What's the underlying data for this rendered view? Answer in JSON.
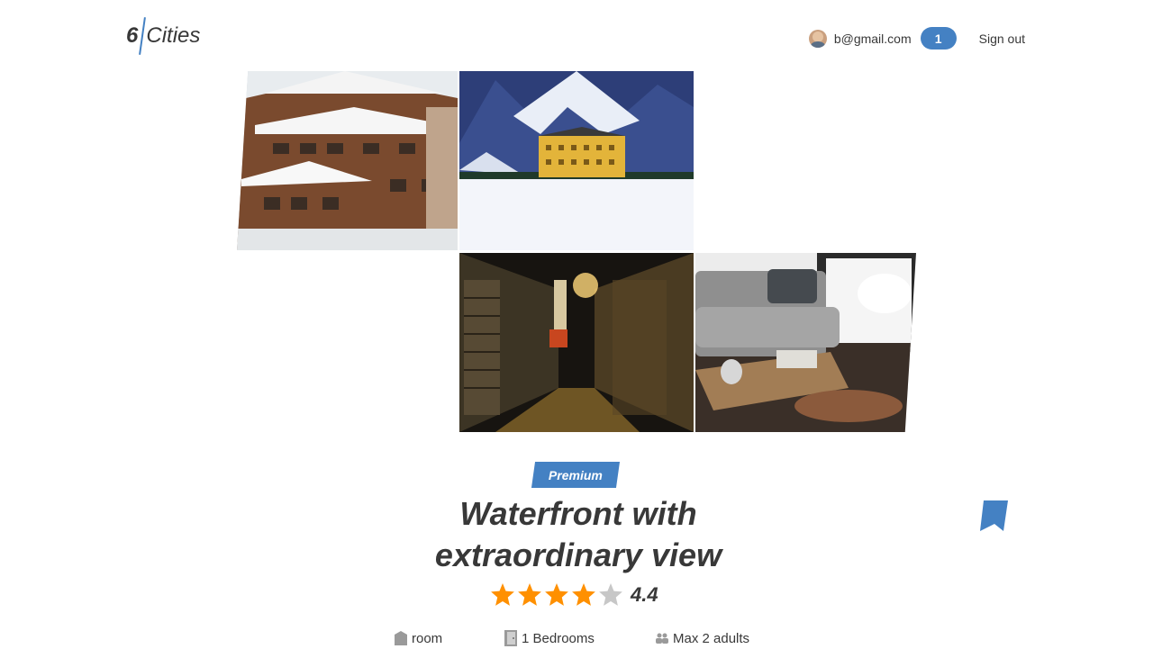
{
  "header": {
    "logo_number": "6",
    "logo_text": "Cities",
    "user_email": "b@gmail.com",
    "favorites_count": "1",
    "signout_label": "Sign out"
  },
  "gallery": {
    "images": [
      {
        "subject": "snowy chalet hotel"
      },
      {
        "subject": "mountain hotel in snow"
      },
      {
        "subject": "hotel alley at night"
      },
      {
        "subject": "living room interior"
      }
    ]
  },
  "offer": {
    "premium_label": "Premium",
    "title": "Waterfront with extraordinary view",
    "rating_value": "4.4",
    "rating_stars": 4,
    "rating_max": 5,
    "features": {
      "type": "room",
      "bedrooms": "1 Bedrooms",
      "adults": "Max 2 adults"
    }
  },
  "colors": {
    "accent": "#4481c3",
    "star_active": "#ff9000",
    "star_inactive": "#c7c7c7",
    "text": "#383838"
  }
}
